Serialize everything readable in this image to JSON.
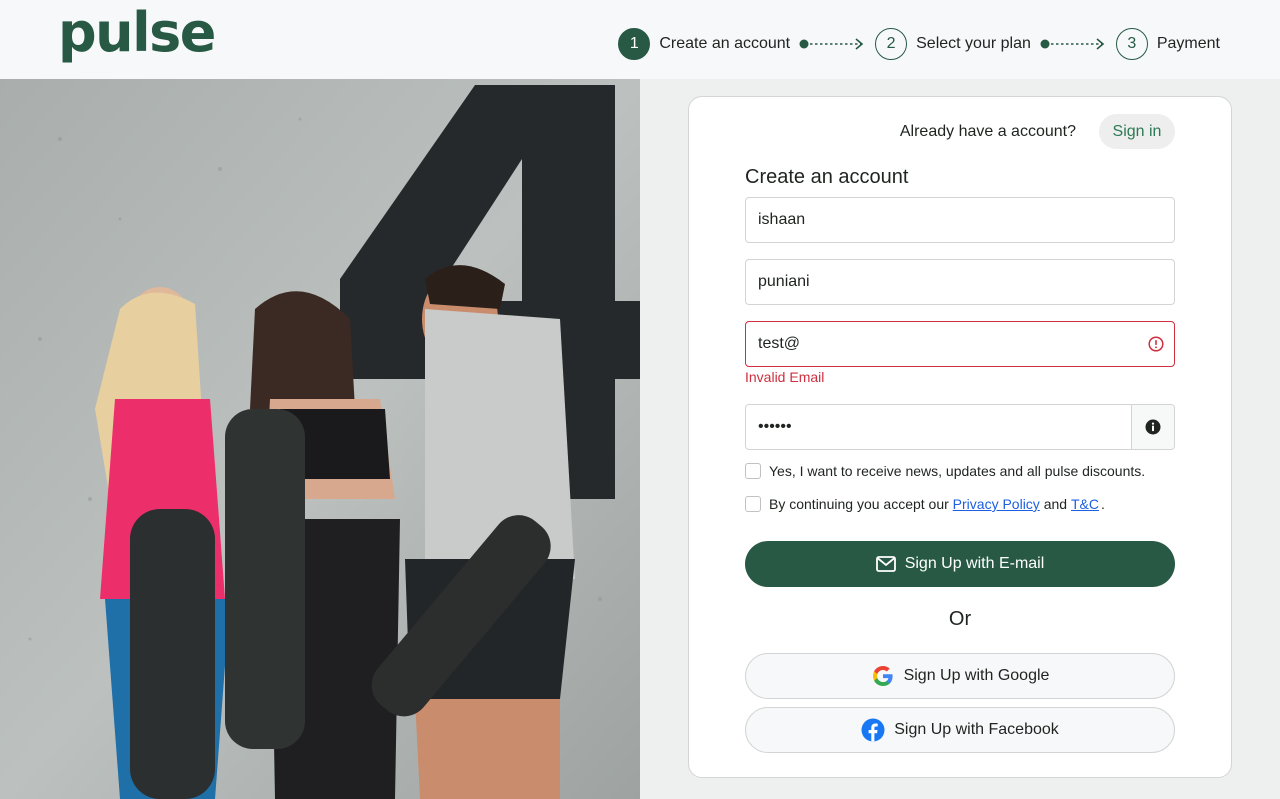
{
  "brand": {
    "logo_text": "pulse",
    "color": "#285944"
  },
  "steps": [
    {
      "number": "1",
      "label": "Create an account",
      "active": true
    },
    {
      "number": "2",
      "label": "Select your plan",
      "active": false
    },
    {
      "number": "3",
      "label": "Payment",
      "active": false
    }
  ],
  "card": {
    "already_text": "Already have a account?",
    "signin_label": "Sign in",
    "title": "Create an account",
    "fields": {
      "first_name": "ishaan",
      "last_name": "puniani",
      "email": "test@",
      "password": "123456"
    },
    "email_error": "Invalid Email",
    "news_checkbox": "Yes, I want to receive news, updates and all pulse discounts.",
    "terms": {
      "prefix": "By continuing you accept our ",
      "privacy": "Privacy Policy",
      "and": " and ",
      "tc": "T&C",
      "suffix": "."
    },
    "email_button": "Sign Up with E-mail",
    "or_text": "Or",
    "google_button": "Sign Up with Google",
    "facebook_button": "Sign Up with Facebook"
  },
  "icons": {
    "error": "exclamation-circle-icon",
    "password_info": "info-circle-icon",
    "email": "envelope-icon",
    "google": "google-icon",
    "facebook": "facebook-icon"
  },
  "colors": {
    "primary": "#285944",
    "error": "#cf2f3f",
    "link": "#1d5fe0",
    "signin_text": "#2c7a53"
  }
}
